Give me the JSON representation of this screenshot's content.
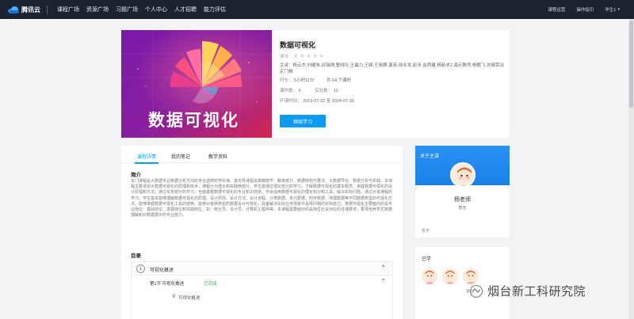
{
  "nav": {
    "logo_text": "腾讯云",
    "items": [
      "课程广场",
      "资源广场",
      "习题广场",
      "个人中心",
      "人才招聘",
      "能力评估"
    ],
    "right_items": [
      "课程运营",
      "操作指引"
    ],
    "user": "学生1"
  },
  "course": {
    "cover_text": "数据可视化",
    "title": "数据可视化",
    "rating_label": "评分",
    "stars": 0,
    "teachers_label": "主讲：",
    "teachers": "杨云杰,刘曜朱,邱瑞琪,曹晓玲,王福力,王颖,王晓静,姜英,徐永发,赵涉,金两建,杨新求2,演示教师,杨鹏飞,刘健荣法定门禍",
    "duration_label": "时长：",
    "duration": "5小时11分",
    "total_label": "共 64 个课时",
    "lessons_label": "课件数：",
    "lessons": "0",
    "experiments_label": "实验数：",
    "experiments": "12",
    "open_label": "开课时间：",
    "open_time": "2019-07-22 至 2024-07-30",
    "continue_button": "继续学习"
  },
  "tabs": [
    "课程详情",
    "我的笔记",
    "教学资料"
  ],
  "intro": {
    "heading": "简介",
    "text": "本门课程是大数据专业数据分析方向的专业选修的学科课。其先导课程是离散数学、概率统计、数据结构与算法、大数据导论、数据分析与实践。本课程主要讲授大数据可视化的原理和技术，课程分为理论和实践两部分，学生能通过理论部分的学习，了解数据可视化的基本概念、掌握数据可视化的设计原理和方法；通过实务部分的学习，全面掌握数据可视化的专业知识技能，学会运用数据可视化的理论知识和工具，解决实际问题。通过对该课程的学习，学生基本能够理解数据可视化的原理、设计原则、设计方法、设计流程、分类数据、多元数据、时序数据、地理数据等不同数据类型的可视化方法，能够掌握数据可视化工具的使用，能够对各种类型的数据设计可视化，具备解决实际业务场景中具体问题的实际能力。数据可视化主要面向的是专业岗位：基础岗位、发展岗位和实践岗位。如：统计员、设计员、计算机工程师等。本课程需要面对的是岗位社会对应的任课要求，要求培养学生数据理解和对数据展示的专业能力。"
  },
  "toc": {
    "heading": "目录",
    "chapter_num": "1",
    "chapter_title": "可视化概述",
    "section_label": "第1节 可视化概述",
    "section_status": "已完成",
    "lesson_label": "可视化概述"
  },
  "lecturer": {
    "card_title": "关于主讲",
    "name": "杨老师",
    "subtitle": "暂无",
    "intro": "暂无"
  },
  "students": {
    "card_title": "已学",
    "names": [
      "",
      "",
      "学生"
    ]
  },
  "watermark": "烟台新工科研究院",
  "colors": {
    "accent": "#0a9cf5",
    "topbar": "#1b2230",
    "success": "#22b14c"
  }
}
